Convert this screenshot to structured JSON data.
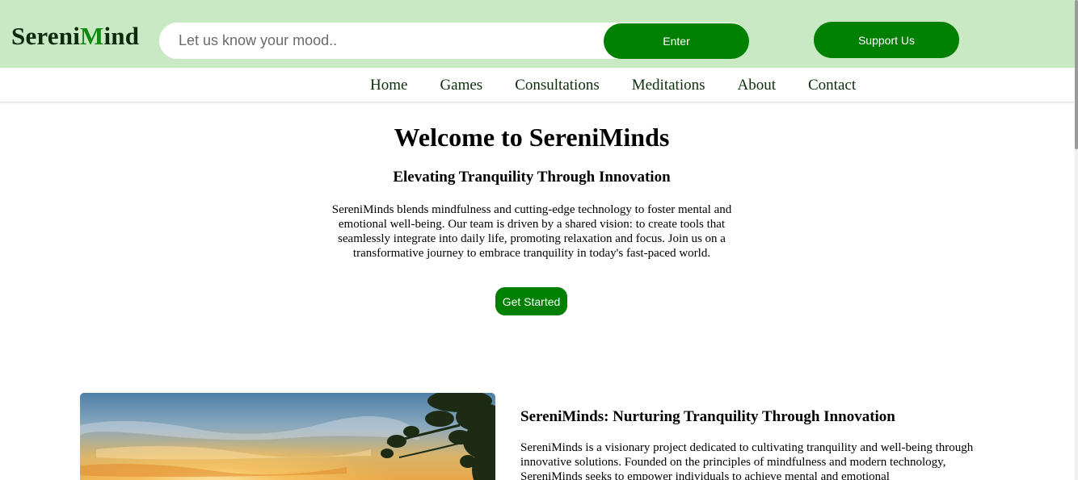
{
  "header": {
    "logo_part1": "Sereni",
    "logo_part2": "M",
    "logo_part3": "ind",
    "mood_placeholder": "Let us know your mood..",
    "enter_label": "Enter",
    "support_label": "Support Us"
  },
  "nav": {
    "items": [
      "Home",
      "Games",
      "Consultations",
      "Meditations",
      "About",
      "Contact"
    ]
  },
  "hero": {
    "title": "Welcome to SereniMinds",
    "subtitle": "Elevating Tranquility Through Innovation",
    "description": "SereniMinds blends mindfulness and cutting-edge technology to foster mental and emotional well-being. Our team is driven by a shared vision: to create tools that seamlessly integrate into daily life, promoting relaxation and focus. Join us on a transformative journey to embrace tranquility in today's fast-paced world.",
    "cta_label": "Get Started"
  },
  "feature": {
    "title": "SereniMinds: Nurturing Tranquility Through Innovation",
    "text": "SereniMinds is a visionary project dedicated to cultivating tranquility and well-being through innovative solutions. Founded on the principles of mindfulness and modern technology, SereniMinds seeks to empower individuals to achieve mental and emotional"
  },
  "colors": {
    "header_bg": "#c8e9c4",
    "brand_green": "#008000",
    "logo_accent": "#0f8a0f",
    "nav_text": "#0b2d0b"
  }
}
